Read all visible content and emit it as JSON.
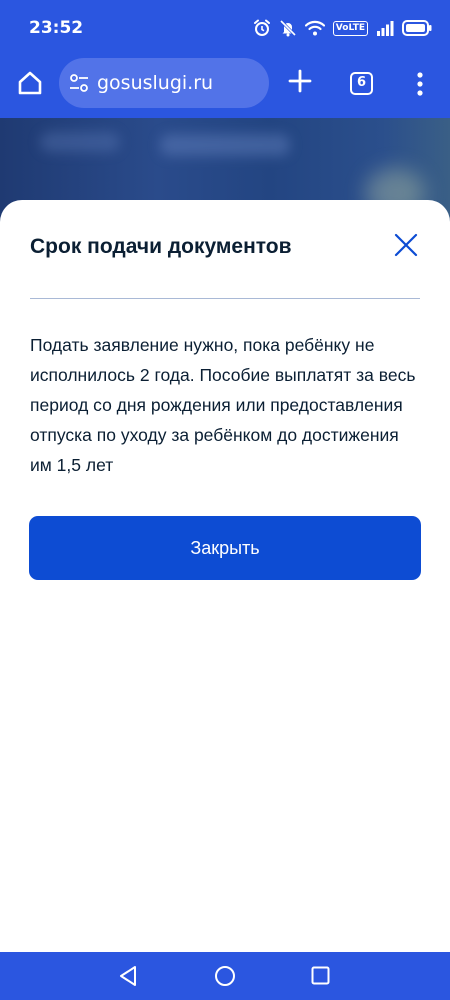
{
  "status_bar": {
    "time": "23:52",
    "icons": [
      "alarm-icon",
      "bell-muted-icon",
      "wifi-icon",
      "volte-badge",
      "signal-icon",
      "battery-icon"
    ],
    "volte_label": "VoLTE"
  },
  "browser": {
    "url": "gosuslugi.ru",
    "tab_count": "6",
    "icons": [
      "home-icon",
      "site-settings-icon",
      "plus-icon",
      "tabs-icon",
      "more-vert-icon"
    ]
  },
  "dialog": {
    "title": "Срок подачи документов",
    "body": "Подать заявление нужно, пока ребёнку не исполнилось 2 года. Пособие выплатят за весь период со дня рождения или предоставления отпуска по уходу за ребёнком до достижения им 1,5 лет",
    "close_button_label": "Закрыть"
  },
  "nav_bar": {
    "icons": [
      "back-icon",
      "home-circle-icon",
      "recents-icon"
    ]
  },
  "colors": {
    "brand_blue": "#2b56e0",
    "button_blue": "#0d4cd3",
    "text_dark": "#0b1f33",
    "divider": "#a9b9d6"
  }
}
